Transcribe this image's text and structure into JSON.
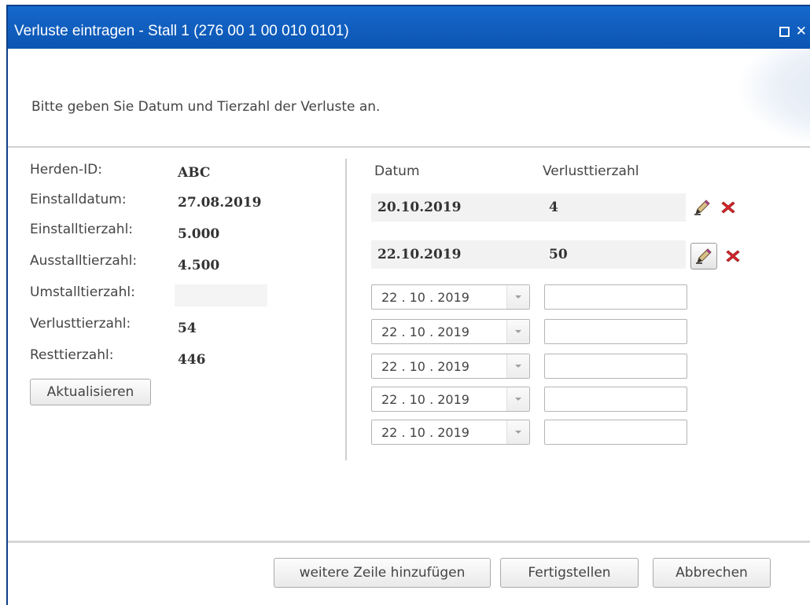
{
  "window": {
    "title": "Verluste eintragen - Stall 1 (276 00 1 00 010 0101)"
  },
  "instruction": "Bitte geben Sie Datum und Tierzahl der Verluste an.",
  "summary": {
    "herden_id": {
      "label": "Herden-ID:",
      "value": "ABC"
    },
    "einstalldatum": {
      "label": "Einstalldatum:",
      "value": "27.08.2019"
    },
    "einstalltierzahl": {
      "label": "Einstalltierzahl:",
      "value": "5.000"
    },
    "ausstalltierzahl": {
      "label": "Ausstalltierzahl:",
      "value": "4.500"
    },
    "umstalltierzahl": {
      "label": "Umstalltierzahl:",
      "value": ""
    },
    "verlusttierzahl": {
      "label": "Verlusttierzahl:",
      "value": "54"
    },
    "resttierzahl": {
      "label": "Resttierzahl:",
      "value": "446"
    },
    "refresh_label": "Aktualisieren"
  },
  "losses": {
    "columns": {
      "date": "Datum",
      "count": "Verlusttierzahl"
    },
    "entries": [
      {
        "date": "20.10.2019",
        "count": "4"
      },
      {
        "date": "22.10.2019",
        "count": "50"
      }
    ],
    "new_rows": [
      {
        "date": "22 . 10 . 2019",
        "count": ""
      },
      {
        "date": "22 . 10 . 2019",
        "count": ""
      },
      {
        "date": "22 . 10 . 2019",
        "count": ""
      },
      {
        "date": "22 . 10 . 2019",
        "count": ""
      },
      {
        "date": "22 . 10 . 2019",
        "count": ""
      }
    ]
  },
  "footer": {
    "add_row_label": "weitere Zeile hinzufügen",
    "finish_label": "Fertigstellen",
    "cancel_label": "Abbrechen"
  },
  "icons": {
    "maximize": "maximize-icon",
    "close": "close-icon",
    "edit": "edit-pencil-icon",
    "delete": "delete-x-icon",
    "dropdown": "chevron-down-icon"
  },
  "colors": {
    "titlebar": "#0b55b2",
    "delete": "#d9262b"
  }
}
